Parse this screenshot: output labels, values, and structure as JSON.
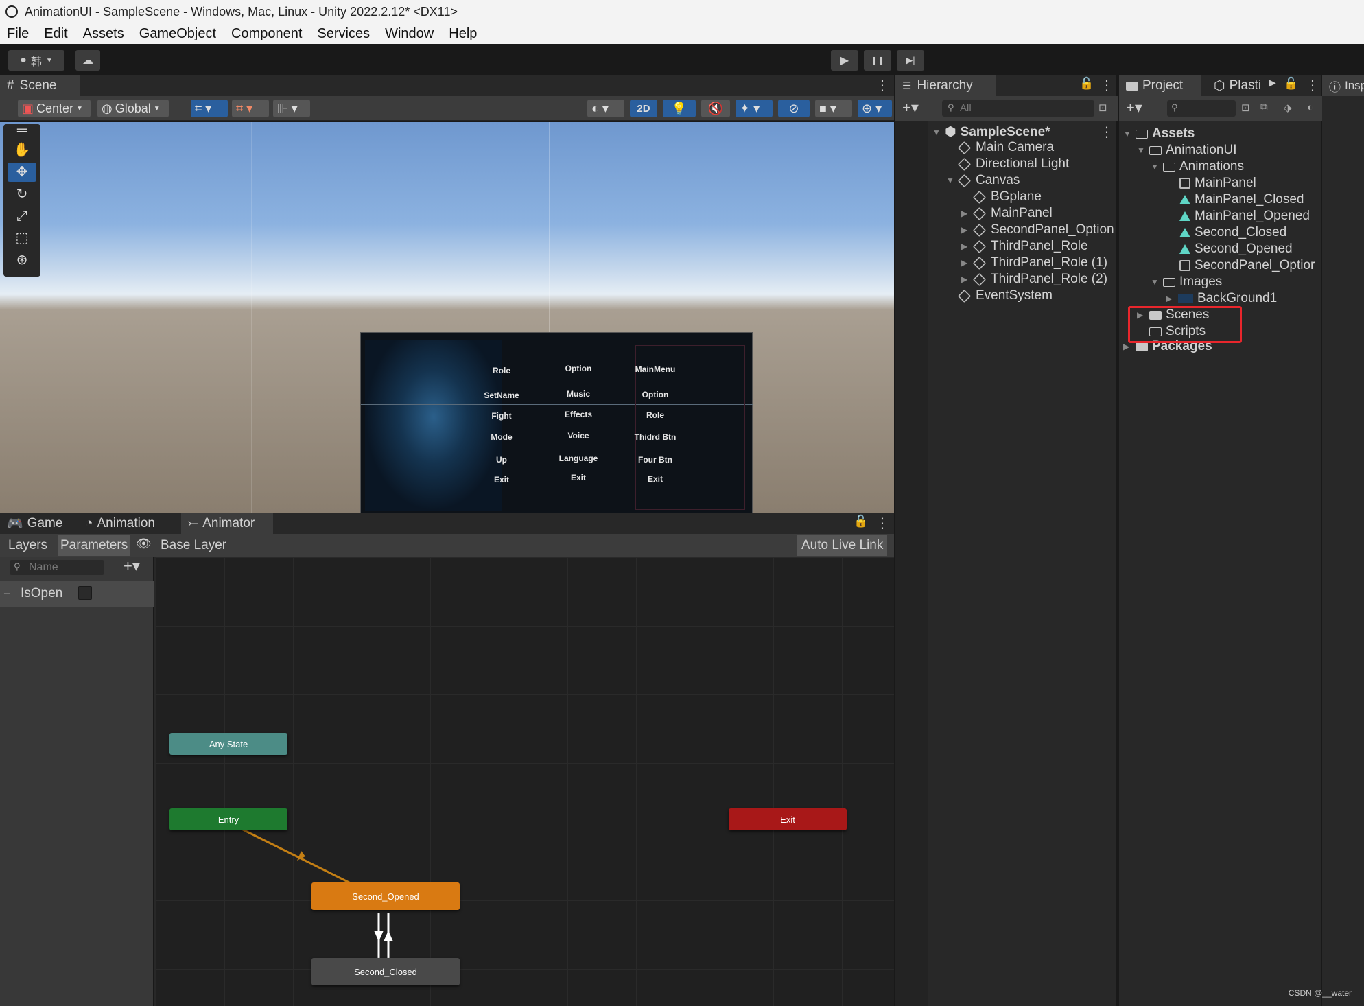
{
  "window": {
    "title": "AnimationUI - SampleScene - Windows, Mac, Linux - Unity 2022.2.12* <DX11>"
  },
  "menu": [
    "File",
    "Edit",
    "Assets",
    "GameObject",
    "Component",
    "Services",
    "Window",
    "Help"
  ],
  "toolbar": {
    "account": "韩",
    "play": "▶",
    "pause": "❚❚",
    "step": "▶|"
  },
  "scene": {
    "tab": "Scene",
    "pivot": "Center",
    "space": "Global",
    "mode_2d": "2D",
    "game_panel": {
      "col1": [
        "Role",
        "SetName",
        "Fight",
        "Mode",
        "Up",
        "Exit"
      ],
      "col2": [
        "Option",
        "Music",
        "Effects",
        "Voice",
        "Language",
        "Exit"
      ],
      "col3": [
        "MainMenu",
        "Option",
        "Role",
        "Thidrd Btn",
        "Four Btn",
        "Exit"
      ]
    }
  },
  "hierarchy": {
    "tab": "Hierarchy",
    "search_placeholder": "All",
    "scene_name": "SampleScene*",
    "items": [
      "Main Camera",
      "Directional Light",
      "Canvas",
      "BGplane",
      "MainPanel",
      "SecondPanel_Option",
      "ThirdPanel_Role",
      "ThirdPanel_Role (1)",
      "ThirdPanel_Role (2)",
      "EventSystem"
    ]
  },
  "project": {
    "tab": "Project",
    "tab2": "Plasti",
    "items": [
      "Assets",
      "AnimationUI",
      "Animations",
      "MainPanel",
      "MainPanel_Closed",
      "MainPanel_Opened",
      "Second_Closed",
      "Second_Opened",
      "SecondPanel_Optior",
      "Images",
      "BackGround1",
      "Scenes",
      "Scripts",
      "Packages"
    ]
  },
  "inspector": {
    "tab": "Insp"
  },
  "animator": {
    "tabs": [
      "Game",
      "Animation",
      "Animator"
    ],
    "layers": "Layers",
    "parameters": "Parameters",
    "base_layer": "Base Layer",
    "auto_live_link": "Auto Live Link",
    "search_placeholder": "Name",
    "param_name": "IsOpen",
    "states": {
      "any": "Any State",
      "entry": "Entry",
      "exit": "Exit",
      "opened": "Second_Opened",
      "closed": "Second_Closed"
    },
    "colors": {
      "any": "#4c8c86",
      "entry": "#1e7a2f",
      "exit": "#a81818",
      "default": "#d97a12",
      "normal": "#494949"
    }
  },
  "watermark": "CSDN @__water"
}
